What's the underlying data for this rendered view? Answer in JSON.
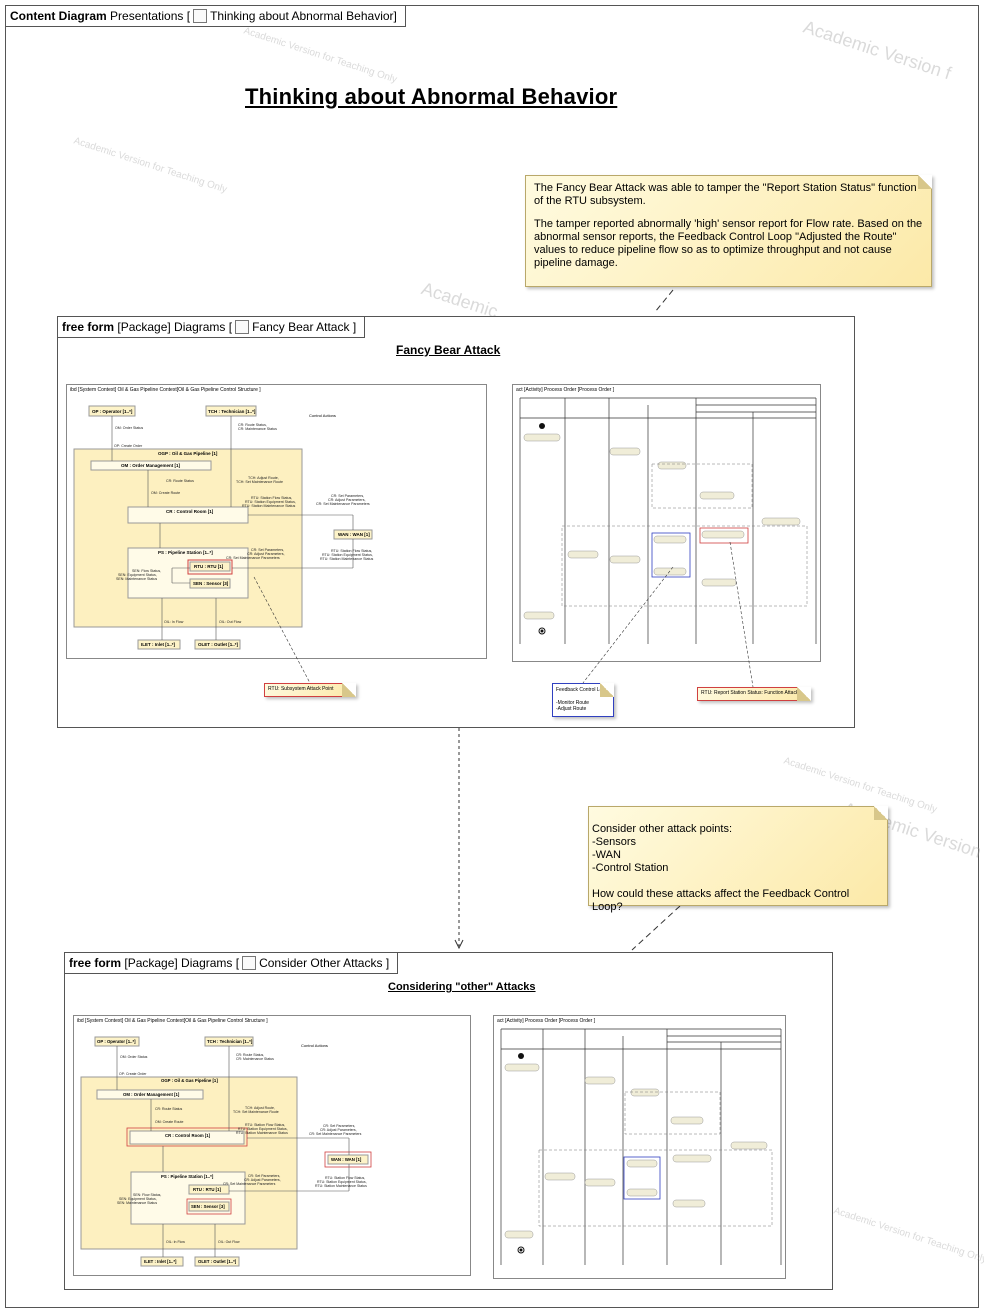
{
  "outer_tab": {
    "kind": "Content Diagram",
    "path": "Presentations [",
    "name": "Thinking about Abnormal Behavior",
    "close": "]"
  },
  "main_title": "Thinking about Abnormal Behavior",
  "note_top": {
    "para1": "The Fancy Bear Attack was able to tamper the \"Report Station Status\" function of the RTU subsystem.",
    "para2": "The tamper reported abnormally 'high' sensor report for Flow rate.  Based on the abnormal sensor reports, the Feedback Control Loop \"Adjusted the Route\" values to reduce pipeline flow so as to optimize throughput and not cause pipeline damage."
  },
  "note_bottom": {
    "line1": "Consider other attack points:",
    "line2": "-Sensors",
    "line3": "-WAN",
    "line4": "-Control Station",
    "line5": "How could these attacks affect the Feedback Control Loop?"
  },
  "frame1": {
    "kind": "free form",
    "pkg": "[Package] Diagrams [",
    "name": "Fancy Bear Attack",
    "close": "]",
    "title": "Fancy Bear  Attack"
  },
  "frame2": {
    "kind": "free form",
    "pkg": "[Package] Diagrams [",
    "name": "Consider Other Attacks",
    "close": "]",
    "title": "Considering \"other\" Attacks"
  },
  "ibd": {
    "header": "ibd [System Context] Oil & Gas Pipeline Context[",
    "header2": "Oil & Gas Pipeline Control Structure ]",
    "op": "OP : Operator [1..*]",
    "tch": "TCH : Technician [1..*]",
    "control_actions": "Control Actions",
    "ogp": "OGP : Oil & Gas Pipeline [1]",
    "om": "OM : Order Management [1]",
    "cr": "CR : Control Room [1]",
    "wan": "WAN : WAN [1]",
    "ps": "PS : Pipeline Station [1..*]",
    "rtu": "RTU : RTU [1]",
    "sen": "SEN : Sensor [3]",
    "ilet": "ILET : Inlet [1..*]",
    "olet": "OLET : Outlet [1..*]",
    "lbl_om_order_status": "OM: Order Status",
    "lbl_op_create_order": "OP: Create Order",
    "lbl_cr_route_status": "CR: Route Status,",
    "lbl_cr_maint_status": "CR: Maintenance Status",
    "lbl_cr_route_status2": "CR: Route Status",
    "lbl_om_create_route": "OM: Create Route",
    "lbl_tch_adjust": "TCH: Adjust Route,",
    "lbl_tch_maint": "TCH: Set Maintenance Route",
    "lbl_rtu_flow": "RTU: Station Flow Status,",
    "lbl_rtu_equip": "RTU: Station Equipment Status,",
    "lbl_rtu_maint": "RTU: Station Maintenance Status",
    "lbl_cr_set_params": "CR: Set Parameters,",
    "lbl_cr_adj_params": "CR: Adjust Parameters,",
    "lbl_cr_maint_params": "CR: Set Maintenance Parameters",
    "lbl_sen_flow": "SEN: Flow Status,",
    "lbl_sen_equip": "SEN: Equipment Status,",
    "lbl_sen_maint": "SEN: Maintenance Status",
    "lbl_oil_in": "OIL: In Flow",
    "lbl_oil_out": "OIL: Out Flow"
  },
  "act": {
    "header": "act [Activity] Process Order [",
    "header2": "Process Order ]"
  },
  "callouts": {
    "rtu_attack": "RTU: Subsystem Attack Point",
    "feedback_title": "Feedback Control Loop:",
    "feedback_l1": "-Monitor Route",
    "feedback_l2": "-Adjust Route",
    "rtu_status": "RTU: Report Station Status: Function Attacked"
  },
  "watermark": "Academic Version for Teaching Only - Commercial Development is strictly Prohibited",
  "colors": {
    "note_fill": "#fdf0b8",
    "red_highlight": "#d04040",
    "blue_highlight": "#3040c0",
    "part_fill": "#fdf3c8"
  }
}
